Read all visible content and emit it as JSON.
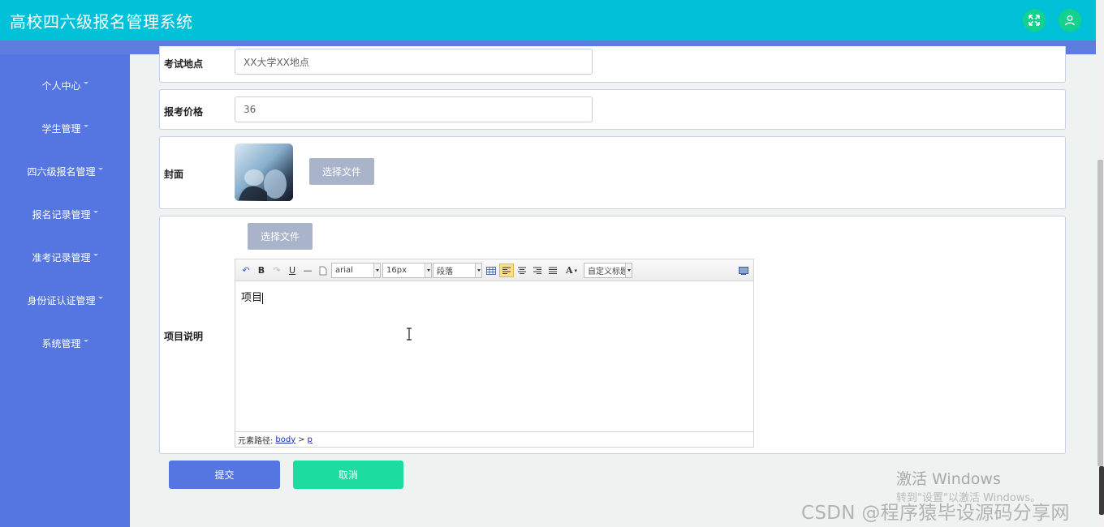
{
  "header": {
    "app_title": "高校四六级报名管理系统",
    "fullscreen_icon": "fullscreen-icon",
    "user_icon": "user-icon",
    "accent": "#00c1d8"
  },
  "sidebar": {
    "items": [
      {
        "label": "个人中心"
      },
      {
        "label": "学生管理"
      },
      {
        "label": "四六级报名管理"
      },
      {
        "label": "报名记录管理"
      },
      {
        "label": "准考记录管理"
      },
      {
        "label": "身份证认证管理"
      },
      {
        "label": "系统管理"
      }
    ]
  },
  "form": {
    "location": {
      "label": "考试地点",
      "value": "XX大学XX地点"
    },
    "price": {
      "label": "报考价格",
      "value": "36"
    },
    "cover": {
      "label": "封面",
      "button": "选择文件"
    },
    "description": {
      "label": "项目说明",
      "upload_button": "选择文件",
      "toolbar": {
        "font": "arial",
        "size": "16px",
        "paragraph": "段落",
        "custom_title": "自定义标题"
      },
      "content": "项目",
      "path_label": "元素路径:",
      "path_body": "body",
      "path_sep": ">",
      "path_p": "p"
    }
  },
  "actions": {
    "submit": "提交",
    "cancel": "取消"
  },
  "overlay": {
    "activate_title": "激活 Windows",
    "activate_sub": "转到\"设置\"以激活 Windows。",
    "csdn": "CSDN @程序猿毕设源码分享网"
  }
}
